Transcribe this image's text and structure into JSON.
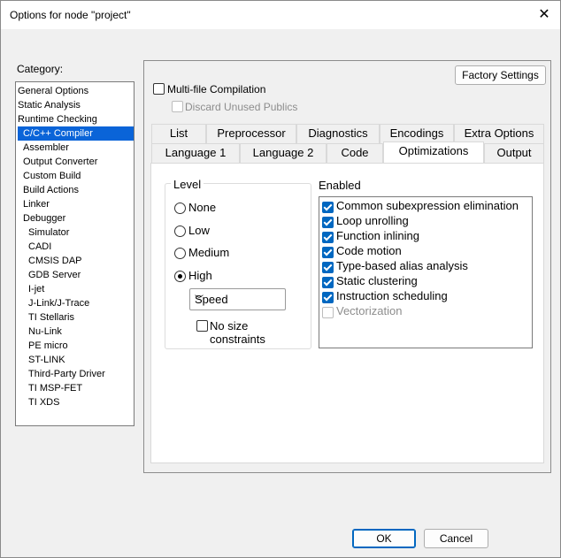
{
  "window": {
    "title": "Options for node \"project\"",
    "close_glyph": "✕"
  },
  "category": {
    "label": "Category:",
    "items": [
      {
        "label": "General Options",
        "indent": 0
      },
      {
        "label": "Static Analysis",
        "indent": 0
      },
      {
        "label": "Runtime Checking",
        "indent": 0
      },
      {
        "label": "C/C++ Compiler",
        "indent": 1,
        "selected": true
      },
      {
        "label": "Assembler",
        "indent": 1
      },
      {
        "label": "Output Converter",
        "indent": 1
      },
      {
        "label": "Custom Build",
        "indent": 1
      },
      {
        "label": "Build Actions",
        "indent": 1
      },
      {
        "label": "Linker",
        "indent": 1
      },
      {
        "label": "Debugger",
        "indent": 1
      },
      {
        "label": "Simulator",
        "indent": 2
      },
      {
        "label": "CADI",
        "indent": 2
      },
      {
        "label": "CMSIS DAP",
        "indent": 2
      },
      {
        "label": "GDB Server",
        "indent": 2
      },
      {
        "label": "I-jet",
        "indent": 2
      },
      {
        "label": "J-Link/J-Trace",
        "indent": 2
      },
      {
        "label": "TI Stellaris",
        "indent": 2
      },
      {
        "label": "Nu-Link",
        "indent": 2
      },
      {
        "label": "PE micro",
        "indent": 2
      },
      {
        "label": "ST-LINK",
        "indent": 2
      },
      {
        "label": "Third-Party Driver",
        "indent": 2
      },
      {
        "label": "TI MSP-FET",
        "indent": 2
      },
      {
        "label": "TI XDS",
        "indent": 2
      }
    ]
  },
  "factory_settings_label": "Factory Settings",
  "multifile": {
    "label": "Multi-file Compilation",
    "checked": false
  },
  "discard": {
    "label": "Discard Unused Publics",
    "checked": false,
    "disabled": true
  },
  "tabs_row1": [
    "List",
    "Preprocessor",
    "Diagnostics",
    "Encodings",
    "Extra Options"
  ],
  "tabs_row2": [
    "Language 1",
    "Language 2",
    "Code",
    "Optimizations",
    "Output"
  ],
  "active_tab": "Optimizations",
  "level": {
    "title": "Level",
    "options": [
      "None",
      "Low",
      "Medium",
      "High"
    ],
    "selected": "High",
    "goal_value": "Speed",
    "no_size_label": "No size constraints",
    "no_size_checked": false
  },
  "enabled": {
    "title": "Enabled",
    "items": [
      {
        "label": "Common subexpression elimination",
        "checked": true
      },
      {
        "label": "Loop unrolling",
        "checked": true
      },
      {
        "label": "Function inlining",
        "checked": true
      },
      {
        "label": "Code motion",
        "checked": true
      },
      {
        "label": "Type-based alias analysis",
        "checked": true
      },
      {
        "label": "Static clustering",
        "checked": true
      },
      {
        "label": "Instruction scheduling",
        "checked": true
      },
      {
        "label": "Vectorization",
        "checked": false,
        "disabled": true
      }
    ]
  },
  "ok_label": "OK",
  "cancel_label": "Cancel",
  "colors": {
    "selection": "#0a64d8",
    "accent": "#0067c0"
  }
}
